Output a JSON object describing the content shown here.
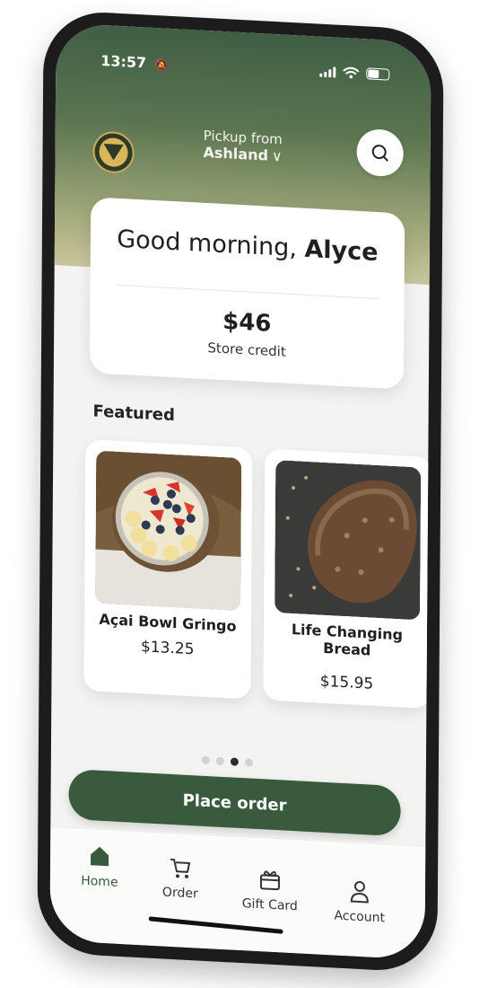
{
  "status_bar": {
    "time": "13:57"
  },
  "header": {
    "pickup_label": "Pickup from",
    "pickup_location": "Ashland",
    "chevron": "∨"
  },
  "greeting": {
    "prefix": "Good morning, ",
    "name": "Alyce"
  },
  "store_credit": {
    "amount": "$46",
    "label": "Store credit"
  },
  "featured": {
    "title": "Featured",
    "items": [
      {
        "name": "Açai Bowl Gringo",
        "price": "$13.25"
      },
      {
        "name": "Life Changing Bread",
        "price": "$15.95"
      }
    ],
    "carousel": {
      "pages": 4,
      "active_index": 2
    }
  },
  "cta": {
    "label": "Place order"
  },
  "tabbar": {
    "items": [
      {
        "label": "Home",
        "icon": "home-icon"
      },
      {
        "label": "Order",
        "icon": "cart-icon"
      },
      {
        "label": "Gift Card",
        "icon": "gift-card-icon"
      },
      {
        "label": "Account",
        "icon": "account-icon"
      }
    ]
  },
  "colors": {
    "brand_green": "#3a5a3e",
    "gold": "#d9b65a"
  }
}
